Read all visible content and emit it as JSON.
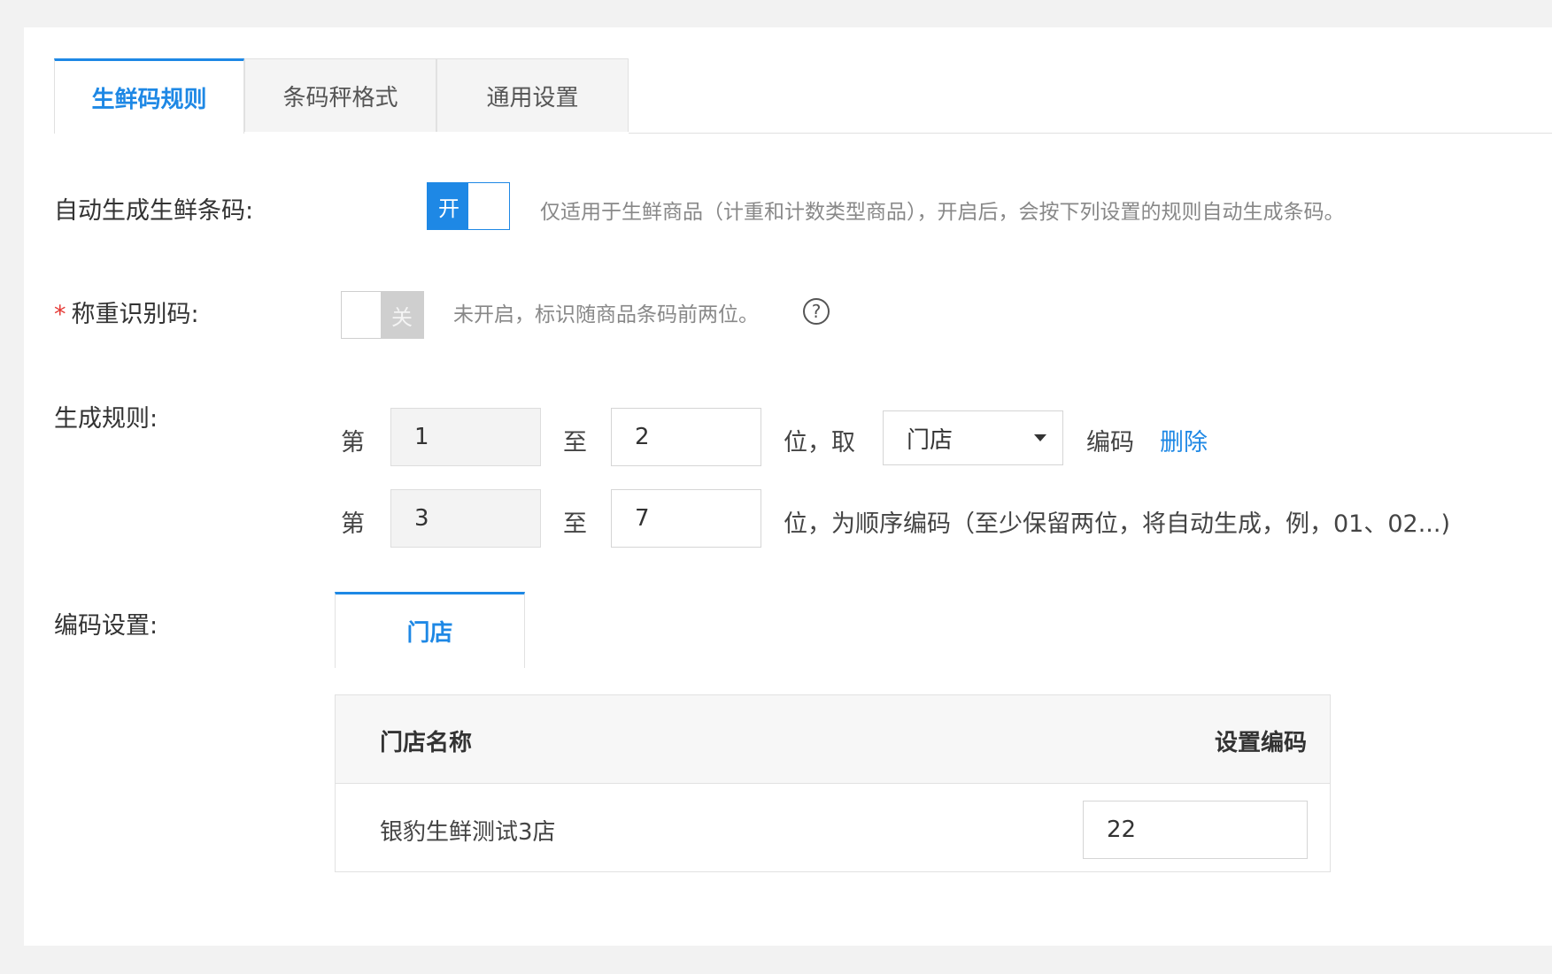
{
  "tabs": [
    {
      "label": "生鲜码规则",
      "active": true
    },
    {
      "label": "条码秤格式",
      "active": false
    },
    {
      "label": "通用设置",
      "active": false
    }
  ],
  "auto_generate": {
    "label": "自动生成生鲜条码:",
    "switch_text": "开",
    "switch_state": "on",
    "hint": "仅适用于生鲜商品（计重和计数类型商品），开启后，会按下列设置的规则自动生成条码。"
  },
  "weight_code": {
    "required_mark": "*",
    "label": "称重识别码:",
    "switch_text": "关",
    "switch_state": "off",
    "hint": "未开启，标识随商品条码前两位。",
    "help_icon": "?"
  },
  "rules": {
    "label": "生成规则:",
    "rows": [
      {
        "prefix": "第",
        "from": "1",
        "to_label": "至",
        "to": "2",
        "suffix": "位，取",
        "select_value": "门店",
        "code_label": "编码",
        "delete_label": "删除"
      },
      {
        "prefix": "第",
        "from": "3",
        "to_label": "至",
        "to": "7",
        "suffix": "位，为顺序编码（至少保留两位，将自动生成，例，01、02...)"
      }
    ]
  },
  "code_settings": {
    "label": "编码设置:",
    "tab": "门店",
    "table": {
      "headers": [
        "门店名称",
        "设置编码"
      ],
      "rows": [
        {
          "name": "银豹生鲜测试3店",
          "code": "22"
        }
      ]
    }
  },
  "colors": {
    "accent": "#1e88e5",
    "required": "#e53935"
  }
}
